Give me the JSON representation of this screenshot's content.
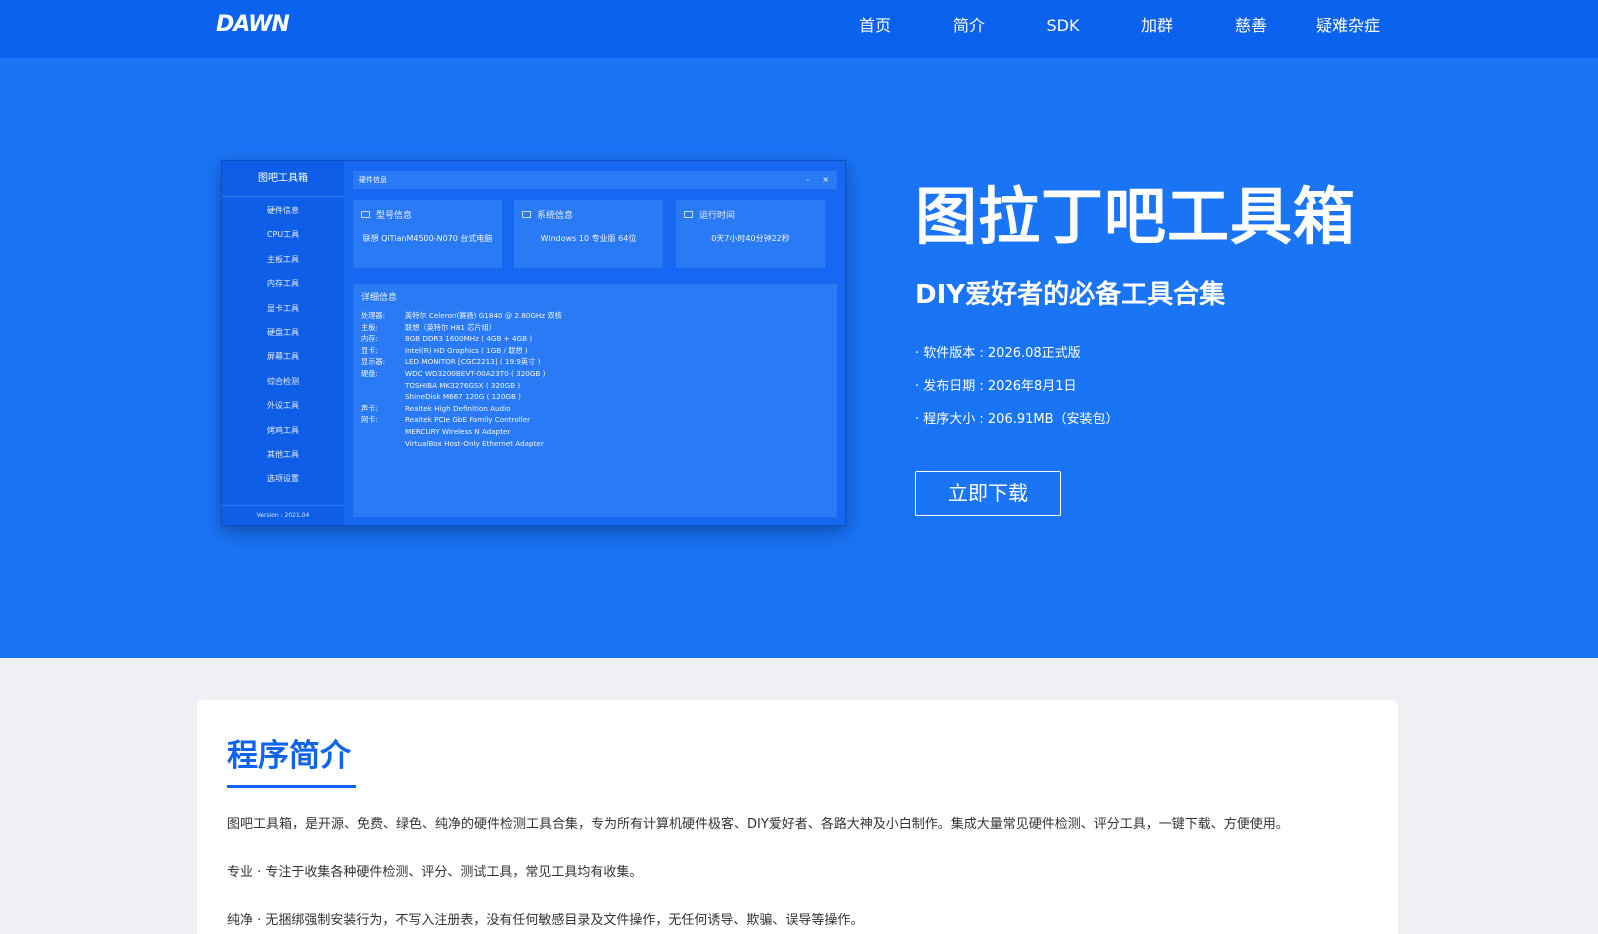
{
  "nav": {
    "logo": "DAWN",
    "items": [
      "首页",
      "简介",
      "SDK",
      "加群",
      "慈善",
      "疑难杂症"
    ]
  },
  "app_mock": {
    "sidebar_title": "图吧工具箱",
    "sidebar_items": [
      "硬件信息",
      "CPU工具",
      "主板工具",
      "内存工具",
      "显卡工具",
      "硬盘工具",
      "屏幕工具",
      "综合检测",
      "外设工具",
      "烤鸡工具",
      "其他工具",
      "选项设置"
    ],
    "version": "Version : 2021.04",
    "window_title": "硬件信息",
    "min_glyph": "-",
    "close_glyph": "×",
    "cards": [
      {
        "title": "型号信息",
        "value": "联想 QiTianM4500-N070 台式电脑"
      },
      {
        "title": "系统信息",
        "value": "Windows 10 专业版 64位"
      },
      {
        "title": "运行时间",
        "value": "0天7小时40分钟22秒"
      }
    ],
    "detail_title": "详细信息",
    "detail_rows": [
      {
        "k": "处理器:",
        "v": "英特尔 Celeron(赛扬) G1840 @ 2.80GHz 双核"
      },
      {
        "k": "主板:",
        "v": "联想（英特尔 H81 芯片组）"
      },
      {
        "k": "内存:",
        "v": "8GB DDR3 1600MHz ( 4GB + 4GB )"
      },
      {
        "k": "显卡:",
        "v": "Intel(R) HD Graphics ( 1GB / 联想 )"
      },
      {
        "k": "显示器:",
        "v": "LED MONITOR [CGC2213] ( 19.9英寸 )"
      },
      {
        "k": "硬盘:",
        "v": "WDC WD3200BEVT-00A23T0 ( 320GB )"
      },
      {
        "k": "",
        "v": "TOSHIBA MK3276GSX ( 320GB )"
      },
      {
        "k": "",
        "v": "ShineDisk M667 120G ( 120GB )"
      },
      {
        "k": "声卡:",
        "v": "Realtek High Definition Audio"
      },
      {
        "k": "网卡:",
        "v": "Realtek PCIe GbE Family Controller"
      },
      {
        "k": "",
        "v": "MERCURY Wireless N Adapter"
      },
      {
        "k": "",
        "v": "VirtualBox Host-Only Ethernet Adapter"
      }
    ]
  },
  "hero": {
    "title": "图拉丁吧工具箱",
    "subtitle": "DIY爱好者的必备工具合集",
    "info": [
      "· 软件版本 : 2026.08正式版",
      "· 发布日期 : 2026年8月1日",
      "· 程序大小 : 206.91MB（安装包）"
    ],
    "download": "立即下载"
  },
  "intro": {
    "title": "程序简介",
    "paragraphs": [
      "图吧工具箱，是开源、免费、绿色、纯净的硬件检测工具合集，专为所有计算机硬件极客、DIY爱好者、各路大神及小白制作。集成大量常见硬件检测、评分工具，一键下载、方便使用。",
      "专业 · 专注于收集各种硬件检测、评分、测试工具，常见工具均有收集。",
      "纯净 · 无捆绑强制安装行为，不写入注册表，没有任何敏感目录及文件操作，无任何诱导、欺骗、误导等操作。"
    ]
  },
  "colors": {
    "nav_bg": "#0a62ee",
    "hero_bg": "#1a74f6",
    "accent": "#1063ee",
    "page_bg": "#eef0f4"
  }
}
